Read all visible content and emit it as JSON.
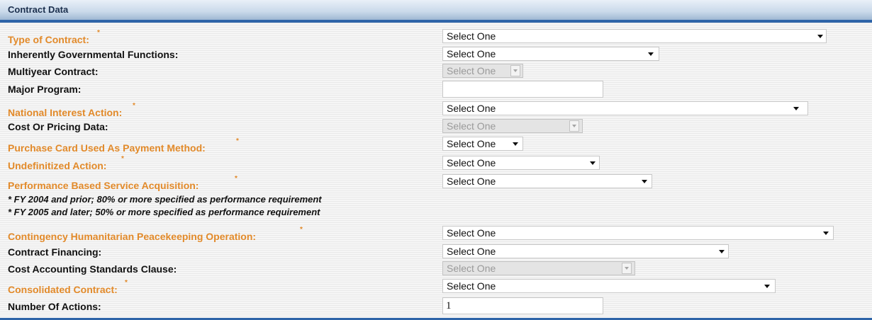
{
  "header": {
    "title": "Contract Data"
  },
  "fields": {
    "type_of_contract": {
      "label": "Type of Contract:",
      "value": "Select One"
    },
    "inherently_governmental": {
      "label": "Inherently Governmental Functions:",
      "value": "Select One"
    },
    "multiyear": {
      "label": "Multiyear Contract:",
      "value": "Select One"
    },
    "major_program": {
      "label": "Major Program:",
      "value": ""
    },
    "national_interest": {
      "label": "National Interest Action:",
      "value": "Select One"
    },
    "cost_pricing": {
      "label": "Cost Or Pricing Data:",
      "value": "Select One"
    },
    "purchase_card": {
      "label": "Purchase Card Used As Payment Method:",
      "value": "Select One"
    },
    "undefinitized": {
      "label": "Undefinitized Action:",
      "value": "Select One"
    },
    "performance_based": {
      "label": "Performance Based Service Acquisition:",
      "value": "Select One",
      "notes": [
        "* FY 2004 and prior; 80% or more specified as performance requirement",
        "* FY 2005 and later; 50% or more specified as performance requirement"
      ]
    },
    "contingency": {
      "label": "Contingency Humanitarian Peacekeeping Operation:",
      "value": "Select One"
    },
    "contract_financing": {
      "label": "Contract Financing:",
      "value": "Select One"
    },
    "cost_accounting": {
      "label": "Cost Accounting Standards Clause:",
      "value": "Select One"
    },
    "consolidated": {
      "label": "Consolidated Contract:",
      "value": "Select One"
    },
    "number_of_actions": {
      "label": "Number Of Actions:",
      "value": "1"
    }
  },
  "required_marker": "*",
  "colors": {
    "required_label": "#e28a2a",
    "header_border": "#2e64a8",
    "header_text": "#1b2f4d"
  }
}
